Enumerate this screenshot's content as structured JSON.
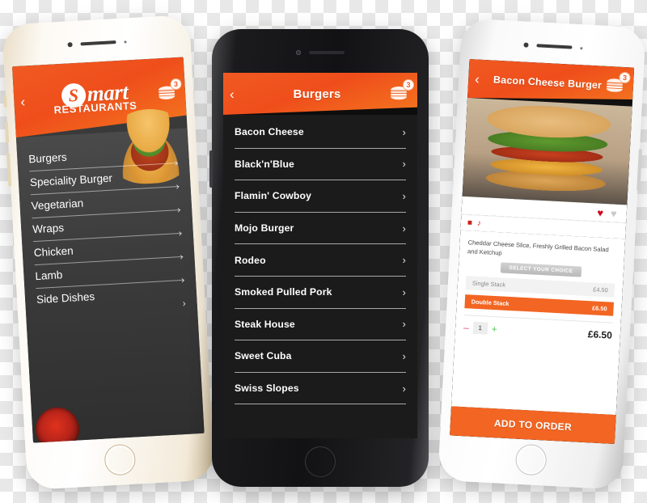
{
  "meta": {
    "accent_orange": "#F26522",
    "header_orange_start": "#F05A22",
    "header_orange_end": "#F4761F",
    "dark_panel": "#3C3C3C",
    "black_panel": "#1B1B1B"
  },
  "phone1": {
    "device_name": "iphone-gold",
    "header": {
      "back_icon": "‹",
      "brand_initial": "S",
      "brand_name": "mart",
      "brand_sub": "RESTAURANTS",
      "cart_icon": "burger-cart-icon",
      "cart_badge": "3"
    },
    "categories": [
      {
        "label": "Burgers",
        "chevron": "›"
      },
      {
        "label": "Speciality Burger",
        "chevron": "›"
      },
      {
        "label": "Vegetarian",
        "chevron": "›"
      },
      {
        "label": "Wraps",
        "chevron": "›"
      },
      {
        "label": "Chicken",
        "chevron": "›"
      },
      {
        "label": "Lamb",
        "chevron": "›"
      },
      {
        "label": "Side Dishes",
        "chevron": "›"
      }
    ]
  },
  "phone2": {
    "device_name": "iphone-black",
    "header": {
      "back_icon": "‹",
      "title": "Burgers",
      "cart_icon": "burger-cart-icon",
      "cart_badge": "3"
    },
    "items": [
      {
        "label": "Bacon Cheese",
        "chevron": "›"
      },
      {
        "label": "Black'n'Blue",
        "chevron": "›"
      },
      {
        "label": "Flamin' Cowboy",
        "chevron": "›"
      },
      {
        "label": "Mojo Burger",
        "chevron": "›"
      },
      {
        "label": "Rodeo",
        "chevron": "›"
      },
      {
        "label": "Smoked Pulled Pork",
        "chevron": "›"
      },
      {
        "label": "Steak House",
        "chevron": "›"
      },
      {
        "label": "Sweet Cuba",
        "chevron": "›"
      },
      {
        "label": "Swiss Slopes",
        "chevron": "›"
      }
    ]
  },
  "phone3": {
    "device_name": "iphone-white",
    "header": {
      "back_icon": "‹",
      "title": "Bacon Cheese Burger",
      "cart_icon": "burger-cart-icon",
      "cart_badge": "3"
    },
    "photo_alt": "bacon-cheese-burger-photo",
    "favourite_on_icon": "♥",
    "favourite_off_icon": "♥",
    "tags": [
      "■",
      "♪"
    ],
    "description": "Cheddar Cheese Slice, Freshly Grilled Bacon Salad and Ketchup",
    "choice_label": "SELECT YOUR CHOICE",
    "options": [
      {
        "label": "Single Stack",
        "price": "£4.50",
        "selected": false
      },
      {
        "label": "Double Stack",
        "price": "£6.50",
        "selected": true
      }
    ],
    "quantity": {
      "minus": "–",
      "value": "1",
      "plus": "+"
    },
    "total": "£6.50",
    "add_button": "ADD TO ORDER"
  }
}
